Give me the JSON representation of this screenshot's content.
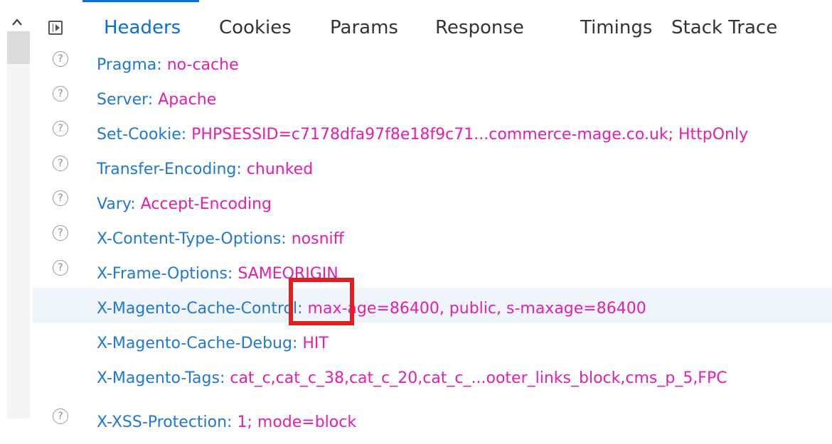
{
  "tabs": [
    {
      "label": "Headers",
      "active": true
    },
    {
      "label": "Cookies"
    },
    {
      "label": "Params"
    },
    {
      "label": "Response"
    },
    {
      "label": "Timings"
    },
    {
      "label": "Stack Trace"
    }
  ],
  "headers": [
    {
      "name": "Pragma:",
      "value": "no-cache"
    },
    {
      "name": "Server:",
      "value": "Apache"
    },
    {
      "name": "Set-Cookie:",
      "value": "PHPSESSID=c7178dfa97f8e18f9c71...commerce-mage.co.uk; HttpOnly"
    },
    {
      "name": "Transfer-Encoding:",
      "value": "chunked"
    },
    {
      "name": "Vary:",
      "value": "Accept-Encoding"
    },
    {
      "name": "X-Content-Type-Options:",
      "value": "nosniff"
    },
    {
      "name": "X-Frame-Options:",
      "value": "SAMEORIGIN"
    },
    {
      "name": "X-Magento-Cache-Control:",
      "value": "max-age=86400, public, s-maxage=86400"
    },
    {
      "name": "X-Magento-Cache-Debug:",
      "value": "HIT"
    },
    {
      "name": "X-Magento-Tags:",
      "value": "cat_c,cat_c_38,cat_c_20,cat_c_...ooter_links_block,cms_p_5,FPC"
    },
    {
      "name": "X-XSS-Protection:",
      "value": "1; mode=block"
    }
  ],
  "help_glyph": "?",
  "colors": {
    "accent": "#0a6fd6",
    "header_name": "#1f78d1",
    "header_value": "#e020b0",
    "annotation": "#e02020"
  }
}
